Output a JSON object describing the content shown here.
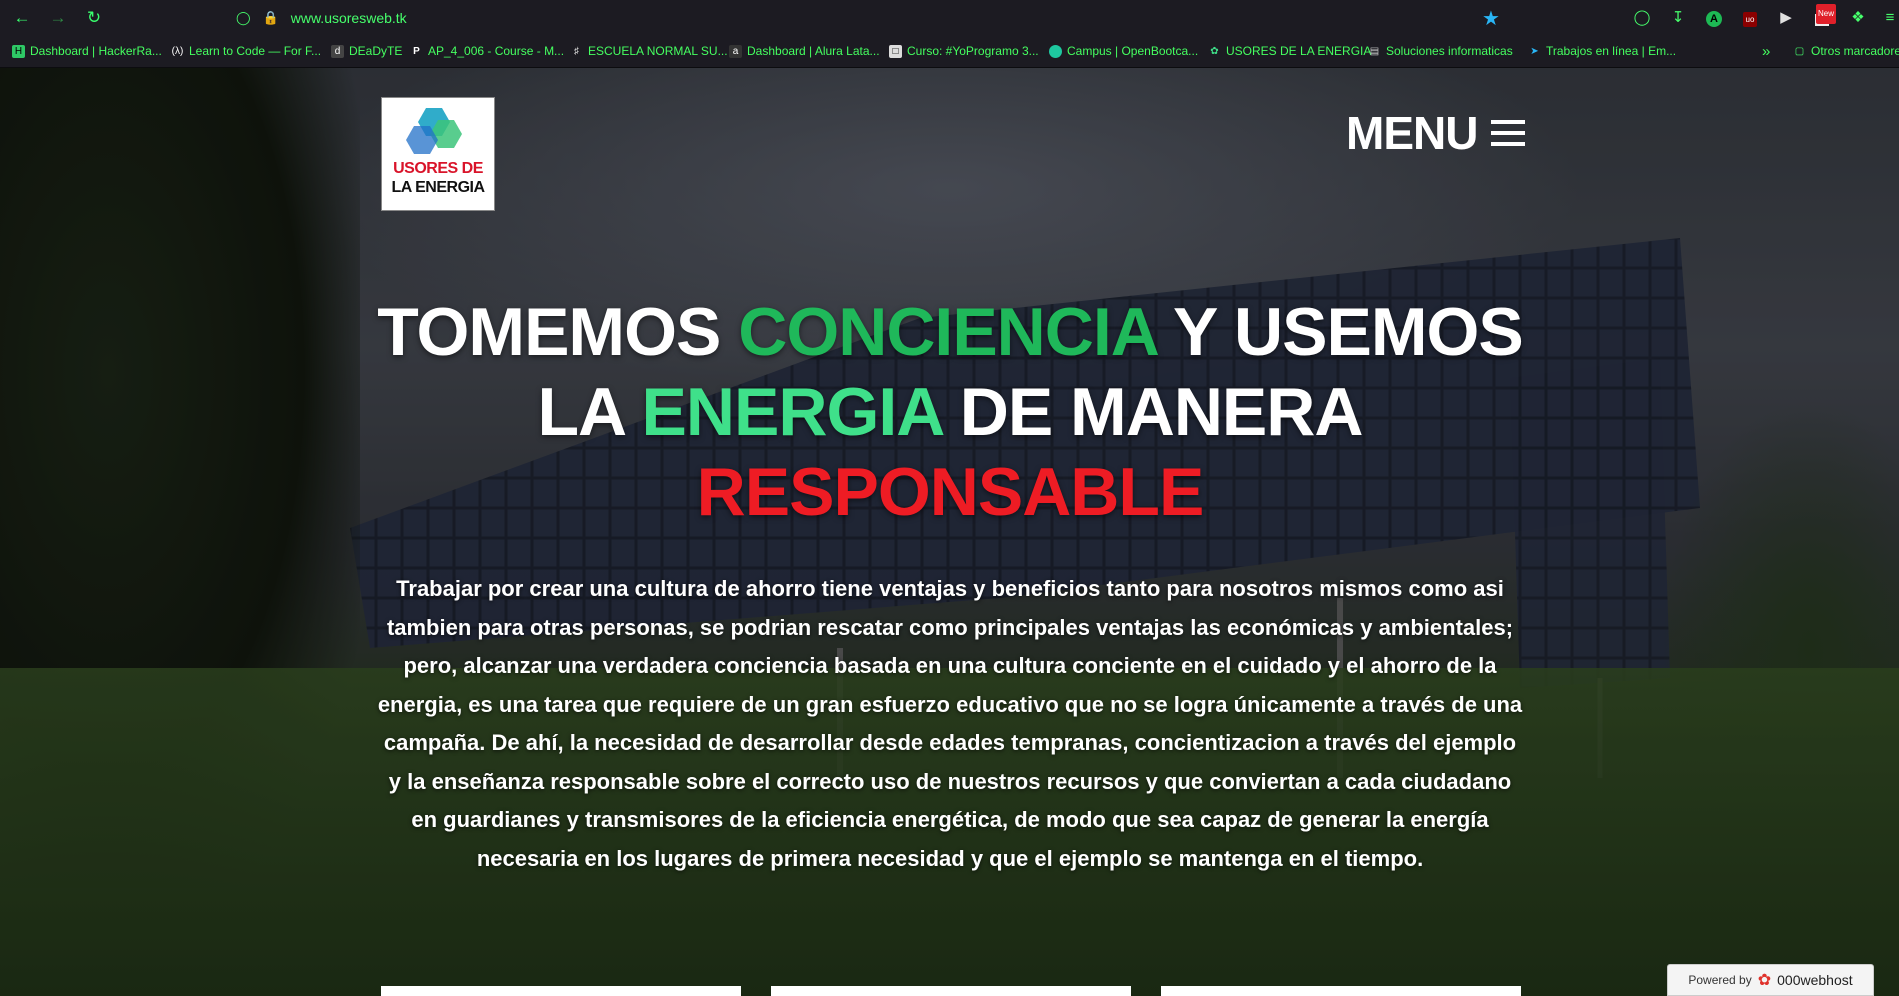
{
  "browser": {
    "url": "www.usoresweb.tk",
    "bookmarks": [
      {
        "label": "Dashboard | HackerRa...",
        "icon": "hackerrank-icon"
      },
      {
        "label": "Learn to Code — For F...",
        "icon": "freecodecamp-icon"
      },
      {
        "label": "DEaDyTE",
        "icon": "deadyte-icon"
      },
      {
        "label": "AP_4_006 - Course - M...",
        "icon": "p-icon"
      },
      {
        "label": "ESCUELA NORMAL SU...",
        "icon": "school-icon"
      },
      {
        "label": "Dashboard | Alura Lata...",
        "icon": "alura-icon"
      },
      {
        "label": "Curso: #YoProgramo 3...",
        "icon": "course-icon"
      },
      {
        "label": "Campus | OpenBootca...",
        "icon": "campus-icon"
      },
      {
        "label": "USORES DE LA ENERGIA",
        "icon": "leaf-icon"
      },
      {
        "label": "Soluciones informaticas",
        "icon": "doc-icon"
      },
      {
        "label": "Trabajos en línea | Em...",
        "icon": "bird-icon"
      }
    ],
    "more": "»",
    "other_bookmarks": "Otros marcadores",
    "ext_badge": "New"
  },
  "site": {
    "logo_line1": "USORES DE",
    "logo_line2": "LA ENERGIA",
    "menu_label": "MENU",
    "headline": {
      "part1": "TOMEMOS ",
      "part2": "CONCIENCIA",
      "part3": " Y USEMOS",
      "part4": "LA ",
      "part5": "ENERGIA",
      "part6": " DE MANERA",
      "part7": "RESPONSABLE"
    },
    "paragraph": "Trabajar por crear una cultura de ahorro tiene ventajas y beneficios tanto para nosotros mismos como asi tambien para otras personas, se podrian rescatar como principales ventajas las económicas y ambientales; pero, alcanzar una verdadera conciencia basada en una cultura conciente en el cuidado y el ahorro de la energia, es una tarea que requiere de un gran esfuerzo educativo que no se logra únicamente a través de una campaña. De ahí, la necesidad de desarrollar desde edades tempranas, concientizacion a través del ejemplo y la enseñanza responsable sobre el correcto uso de nuestros recursos y que conviertan a cada ciudadano en guardianes y transmisores de la eficiencia energética, de modo que sea capaz de generar la energía necesaria en los lugares de primera necesidad y que el ejemplo se mantenga en el tiempo.",
    "powered_by": "Powered by",
    "powered_brand": "000webhost"
  },
  "colors": {
    "green": "#1fb85a",
    "light_green": "#3fe08a",
    "red": "#ee1c24",
    "chrome_accent": "#46ff6c"
  }
}
